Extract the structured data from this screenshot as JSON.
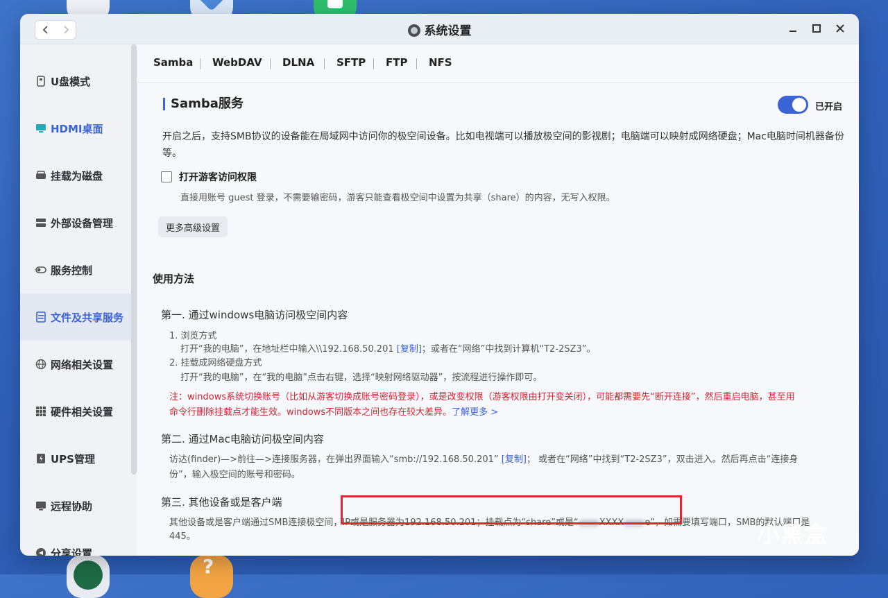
{
  "window": {
    "title": "系统设置"
  },
  "sidebar": {
    "items": [
      {
        "label": "U盘模式",
        "icon": "usb-drive-icon"
      },
      {
        "label": "HDMI桌面",
        "icon": "monitor-icon"
      },
      {
        "label": "挂载为磁盘",
        "icon": "disk-icon"
      },
      {
        "label": "外部设备管理",
        "icon": "device-icon"
      },
      {
        "label": "服务控制",
        "icon": "toggle-icon"
      },
      {
        "label": "文件及共享服务",
        "icon": "file-share-icon"
      },
      {
        "label": "网络相关设置",
        "icon": "globe-icon"
      },
      {
        "label": "硬件相关设置",
        "icon": "grid-icon"
      },
      {
        "label": "UPS管理",
        "icon": "power-icon"
      },
      {
        "label": "远程协助",
        "icon": "remote-icon"
      },
      {
        "label": "分享设置",
        "icon": "share-icon"
      }
    ]
  },
  "tabs": [
    "Samba",
    "WebDAV",
    "DLNA",
    "SFTP",
    "FTP",
    "NFS"
  ],
  "samba": {
    "title": "Samba服务",
    "toggle_label": "已开启",
    "desc": "开启之后，支持SMB协议的设备能在局域网中访问你的极空间设备。比如电视端可以播放极空间的影视剧；电脑端可以映射成网络硬盘；Mac电脑时间机器备份等。",
    "guest_label": "打开游客访问权限",
    "guest_desc": "直接用账号 guest 登录，不需要输密码，游客只能查看极空间中设置为共享（share）的内容，无写入权限。",
    "advanced_btn": "更多高级设置"
  },
  "usage": {
    "title": "使用方法",
    "step1_title": "第一. 通过windows电脑访问极空间内容",
    "step1_a": "1. 浏览方式",
    "step1_a_text_pre": "打开“我的电脑”，在地址栏中输入\\\\192.168.50.201 ",
    "copy": "[复制]",
    "step1_a_text_post": "；或者在“网络”中找到计算机“T2-2SZ3”。",
    "step1_b": "2. 挂载成网络硬盘方式",
    "step1_b_text": "打开“我的电脑”，在“我的电脑”点击右键，选择“映射网络驱动器”，按流程进行操作即可。",
    "warn_line1": "注：windows系统切换账号（比如从游客切换成账号密码登录），或是改变权限（游客权限由打开变关闭），可能都需要先“断开连接”，然后重启电脑，甚至用",
    "warn_line2": "命令行删除挂载点才能生效。windows不同版本之间也存在较大差异。",
    "learn_more": "了解更多 >",
    "step2_title": "第二. 通过Mac电脑访问极空间内容",
    "step2_text_pre": "访达(finder)—>前往—>连接服务器，在弹出界面输入“smb://192.168.50.201” ",
    "step2_text_post": "； 或者在“网络”中找到“T2-2SZ3”，双击进入。然后再点击“连接身",
    "step2_text2": "份”，输入极空间的账号和密码。",
    "step3_title": "第三. 其他设备或是客户端",
    "step3_text_pre": "其他设备或是客户端通过SMB连接极空间，IP或是服务器为192.168.50.201；挂载点为“share”或是“",
    "step3_masked": "XXXX",
    "step3_text_post": "e”，如需要填写端口，SMB的默认端口是",
    "step3_text2": "445。"
  },
  "watermark": "小黑盒",
  "colors": {
    "accent": "#3a63d6",
    "warning": "#d02532",
    "highlight": "#e1262f"
  }
}
